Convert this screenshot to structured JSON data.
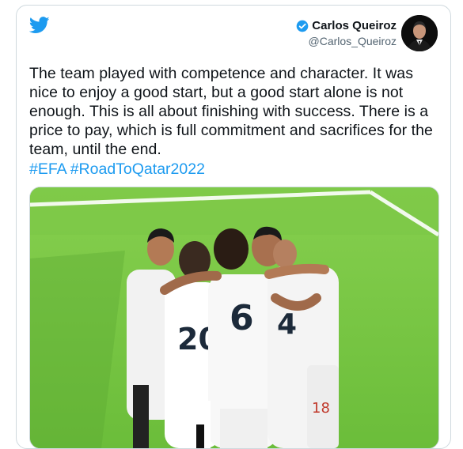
{
  "author": {
    "display_name": "Carlos Queiroz",
    "handle": "@Carlos_Queiroz"
  },
  "tweet": {
    "text": "The team played with competence and character. It was nice to enjoy a good start, but a good start alone is not enough. This is all about finishing with success. There is a price to pay, which is full commitment and sacrifices for the team, until the end.",
    "hashtags": [
      "#EFA",
      "#RoadToQatar2022"
    ]
  },
  "media": {
    "jersey_numbers": [
      "20",
      "6",
      "4",
      "18"
    ]
  },
  "colors": {
    "brand": "#1d9bf0",
    "text": "#0f1419",
    "secondary": "#536471",
    "pitch": "#7ec94a"
  },
  "icons": [
    "twitter-bird-icon",
    "verified-badge-icon"
  ]
}
